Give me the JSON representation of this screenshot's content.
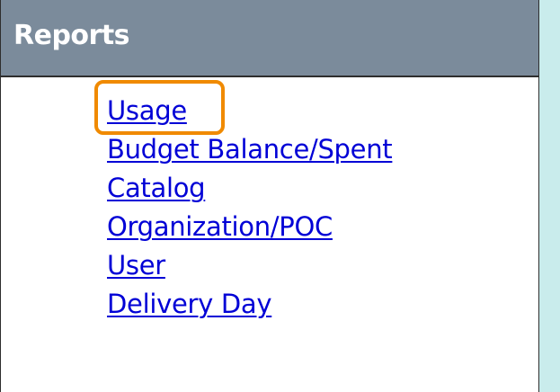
{
  "panel": {
    "title": "Reports",
    "links": [
      {
        "label": "Usage",
        "highlighted": true
      },
      {
        "label": "Budget Balance/Spent",
        "highlighted": false
      },
      {
        "label": "Catalog",
        "highlighted": false
      },
      {
        "label": "Organization/POC",
        "highlighted": false
      },
      {
        "label": "User",
        "highlighted": false
      },
      {
        "label": "Delivery Day",
        "highlighted": false
      }
    ]
  },
  "colors": {
    "background": "#c9ecec",
    "header": "#7b8b9b",
    "link": "#0000d6",
    "highlight": "#f08a00"
  }
}
